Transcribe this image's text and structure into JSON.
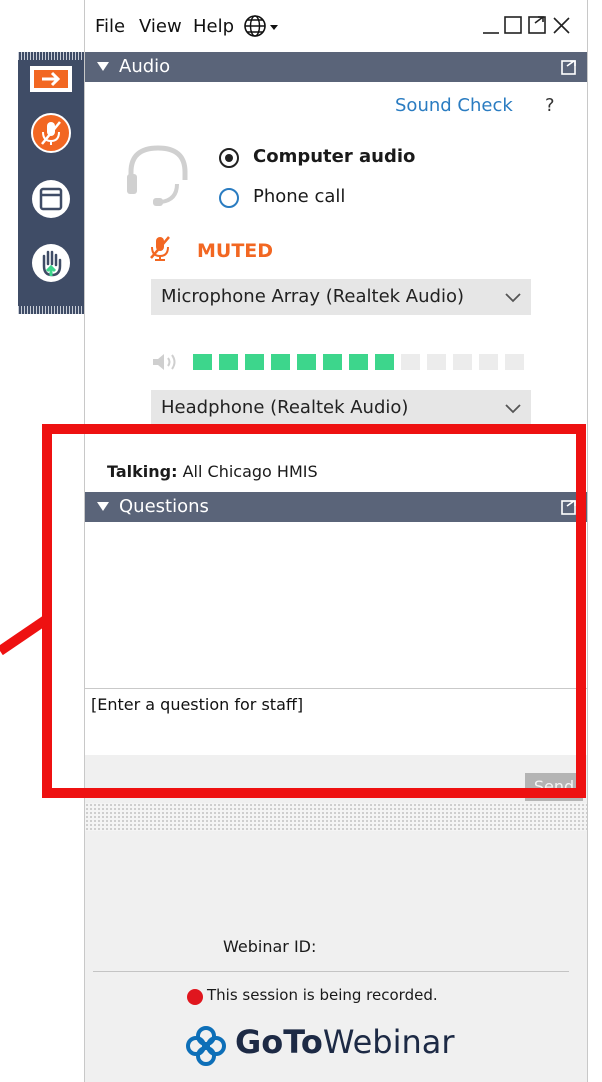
{
  "menubar": {
    "file": "File",
    "view": "View",
    "help": "Help",
    "language_icon": "globe-icon"
  },
  "window_controls": [
    "minimize-icon",
    "maximize-icon",
    "popout-icon",
    "close-icon"
  ],
  "dock": {
    "items": [
      "arrow-right-icon",
      "microphone-muted-icon",
      "window-icon",
      "raise-hand-icon"
    ]
  },
  "audio_panel": {
    "title": "Audio",
    "sound_check": "Sound Check",
    "help": "?",
    "computer_audio": "Computer audio",
    "phone_call": "Phone call",
    "selected_mode": "Computer audio",
    "muted": "MUTED",
    "microphone_device": "Microphone Array (Realtek Audio)",
    "speaker_device": "Headphone (Realtek Audio)",
    "volume_level": {
      "filled": 8,
      "total": 13
    }
  },
  "talking": {
    "label": "Talking:",
    "name": "All Chicago HMIS"
  },
  "questions_panel": {
    "title": "Questions",
    "placeholder": "[Enter a question for staff]",
    "send": "Send"
  },
  "footer": {
    "webinar_id": "Webinar ID:",
    "recording": "This session is being recorded.",
    "brand_bold": "GoTo",
    "brand_light": "Webinar"
  },
  "colors": {
    "header_bg": "#5a6479",
    "dock_bg": "#3f4c66",
    "accent_orange": "#f26722",
    "link_blue": "#2a7cc1",
    "meter_green": "#3dd68c",
    "highlight_red": "#ee1111",
    "brand_blue": "#0d6fb8"
  }
}
